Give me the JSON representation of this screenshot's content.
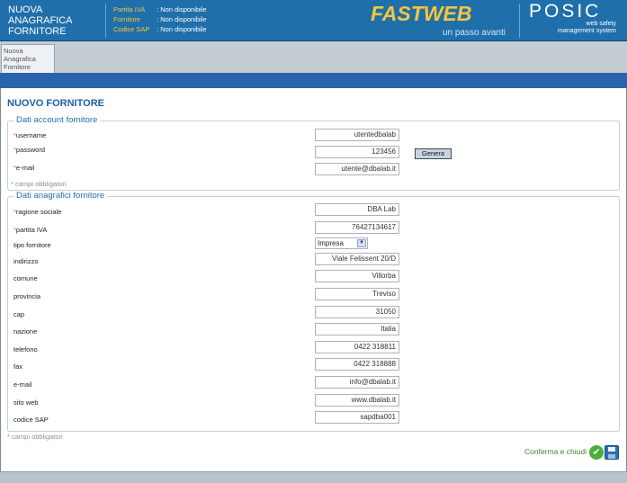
{
  "app": {
    "title_lines": [
      "NUOVA",
      "ANAGRAFICA",
      "FORNITORE"
    ]
  },
  "header_info": [
    {
      "label": "Partita IVA",
      "value": ": Non disponibile"
    },
    {
      "label": "Fornitore",
      "value": ": Non disponibile"
    },
    {
      "label": "Codice SAP",
      "value": ": Non disponibile"
    }
  ],
  "brand": {
    "name": "FASTWEB",
    "tagline": "un passo avanti",
    "product": "POSIC",
    "product_tag1": "web safety",
    "product_tag2": "management system"
  },
  "tab": {
    "label": "Nuova Anagrafica Fornitore"
  },
  "page": {
    "title": "NUOVO FORNITORE"
  },
  "account": {
    "legend": "Dati account fornitore",
    "username_label": "username",
    "username_value": "utentedbalab",
    "password_label": "password",
    "password_value": "123456",
    "email_label": "e-mail",
    "email_value": "utente@dbalab.it",
    "generate_button": "Genera",
    "required_note": "* campi obbligatori"
  },
  "anagrafica": {
    "legend": "Dati anagrafici fornitore",
    "fields": [
      {
        "label": "ragione sociale",
        "value": "DBA Lab",
        "required": "*"
      },
      {
        "label": "partita IVA",
        "value": "76427134617",
        "required": "*"
      },
      {
        "label": "tipo fornitore",
        "value": "Impresa",
        "required": ""
      },
      {
        "label": "indirizzo",
        "value": "Viale Felissent 20/D",
        "required": ""
      },
      {
        "label": "comune",
        "value": "Villorba",
        "required": ""
      },
      {
        "label": "provincia",
        "value": "Treviso",
        "required": ""
      },
      {
        "label": "cap",
        "value": "31050",
        "required": ""
      },
      {
        "label": "nazione",
        "value": "Italia",
        "required": ""
      },
      {
        "label": "telefono",
        "value": "0422 318811",
        "required": ""
      },
      {
        "label": "fax",
        "value": "0422 318888",
        "required": ""
      },
      {
        "label": "e-mail",
        "value": "info@dbalab.it",
        "required": ""
      },
      {
        "label": "sito web",
        "value": "www.dbalab.it",
        "required": ""
      },
      {
        "label": "codice SAP",
        "value": "sapdba001",
        "required": ""
      }
    ],
    "required_note": "* campi obbligatori"
  },
  "actions": {
    "confirm_label": "Conferma e chiudi"
  },
  "colors": {
    "header": "#1f6faa",
    "accent": "#f6c53d",
    "title": "#1f5fa8",
    "confirm": "#3a8a2a"
  },
  "icons": {
    "confirm": "check-circle-icon",
    "save": "floppy-disk-icon",
    "dropdown": "chevron-down-icon"
  }
}
